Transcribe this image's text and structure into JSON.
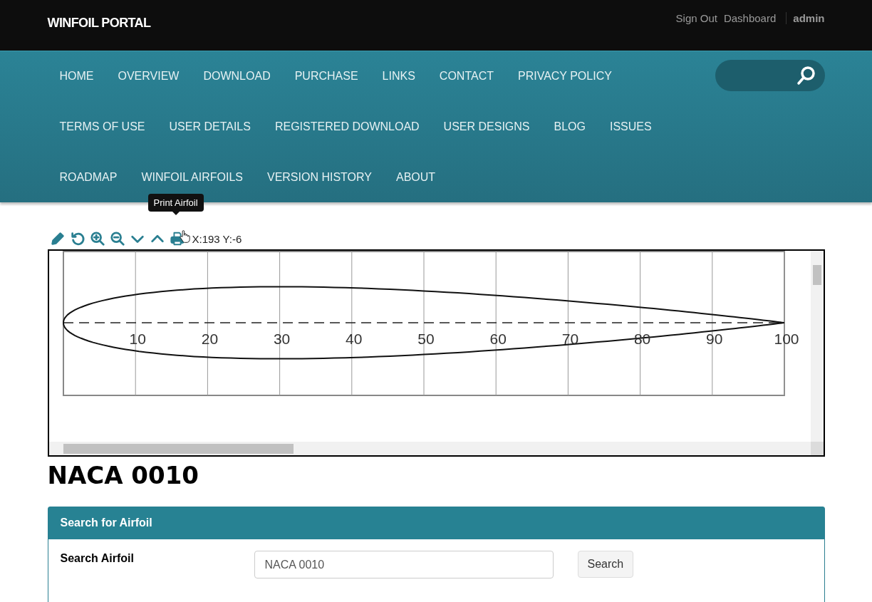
{
  "header": {
    "brand": "WINFOIL PORTAL",
    "links": [
      "Sign Out",
      "Dashboard"
    ],
    "user": "admin"
  },
  "nav": {
    "items": [
      "HOME",
      "OVERVIEW",
      "DOWNLOAD",
      "PURCHASE",
      "LINKS",
      "CONTACT",
      "PRIVACY POLICY",
      "TERMS OF USE",
      "USER DETAILS",
      "REGISTERED DOWNLOAD",
      "USER DESIGNS",
      "BLOG",
      "ISSUES",
      "ROADMAP",
      "WINFOIL AIRFOILS",
      "VERSION HISTORY",
      "ABOUT"
    ]
  },
  "toolbar": {
    "tooltip": "Print Airfoil",
    "coordinates": "X:193 Y:-6"
  },
  "plot": {
    "x_labels": [
      "10",
      "20",
      "30",
      "40",
      "50",
      "60",
      "70",
      "80",
      "90",
      "100"
    ]
  },
  "airfoil_title": "NACA 0010",
  "search_panel": {
    "title": "Search for Airfoil",
    "label": "Search Airfoil",
    "value": "NACA 0010",
    "button": "Search"
  }
}
